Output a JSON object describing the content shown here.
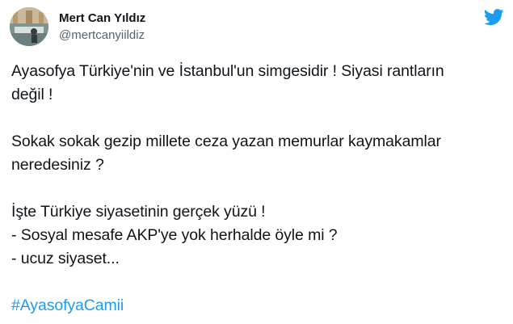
{
  "user": {
    "display_name": "Mert Can Yıldız",
    "handle": "@mertcanyiildiz",
    "avatar_icon": "profile-photo"
  },
  "brand": {
    "icon": "twitter-bird-icon",
    "color": "#1d9bf0"
  },
  "tweet": {
    "lines": [
      "Ayasofya Türkiye'nin ve İstanbul'un simgesidir ! Siyasi rantların",
      "değil !",
      "Sokak sokak gezip millete ceza yazan memurlar kaymakamlar",
      "neredesiniz ?",
      "İşte Türkiye siyasetinin gerçek yüzü !",
      "- Sosyal mesafe AKP'ye yok herhalde öyle mi ?",
      "- ucuz siyaset..."
    ],
    "hashtag": "#AyasofyaCamii"
  }
}
